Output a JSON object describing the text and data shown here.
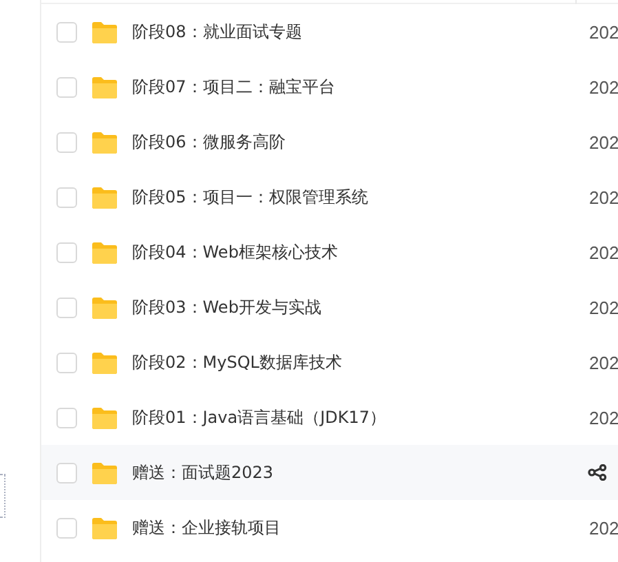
{
  "rows": [
    {
      "name": "阶段08：就业面试专题",
      "date": "202",
      "hovered": false,
      "checked": false
    },
    {
      "name": "阶段07：项目二：融宝平台",
      "date": "202",
      "hovered": false,
      "checked": false
    },
    {
      "name": "阶段06：微服务高阶",
      "date": "202",
      "hovered": false,
      "checked": false
    },
    {
      "name": "阶段05：项目一：权限管理系统",
      "date": "202",
      "hovered": false,
      "checked": false
    },
    {
      "name": "阶段04：Web框架核心技术",
      "date": "202",
      "hovered": false,
      "checked": false
    },
    {
      "name": "阶段03：Web开发与实战",
      "date": "202",
      "hovered": false,
      "checked": false
    },
    {
      "name": "阶段02：MySQL数据库技术",
      "date": "202",
      "hovered": false,
      "checked": false
    },
    {
      "name": "阶段01：Java语言基础（JDK17）",
      "date": "202",
      "hovered": false,
      "checked": false
    },
    {
      "name": "赠送：面试题2023",
      "hovered": true,
      "checked": false
    },
    {
      "name": "赠送：企业接轨项目",
      "date": "202",
      "hovered": false,
      "checked": false
    }
  ]
}
